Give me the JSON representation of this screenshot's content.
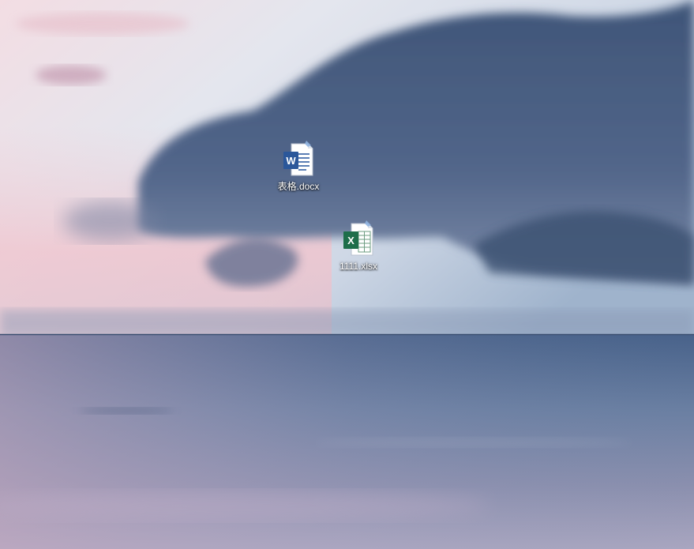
{
  "desktop": {
    "icons": [
      {
        "label": "表格.docx",
        "type": "word-document",
        "icon": "word-document-icon",
        "accent": "#2b579a"
      },
      {
        "label": "1111.xlsx",
        "type": "excel-workbook",
        "icon": "excel-workbook-icon",
        "accent": "#1e6e4a"
      }
    ]
  },
  "colors": {
    "sky_top": "#dfe3ec",
    "sky_pink": "#f2cfd6",
    "cloud": "#4a5f80",
    "sea": "#5a7195"
  }
}
